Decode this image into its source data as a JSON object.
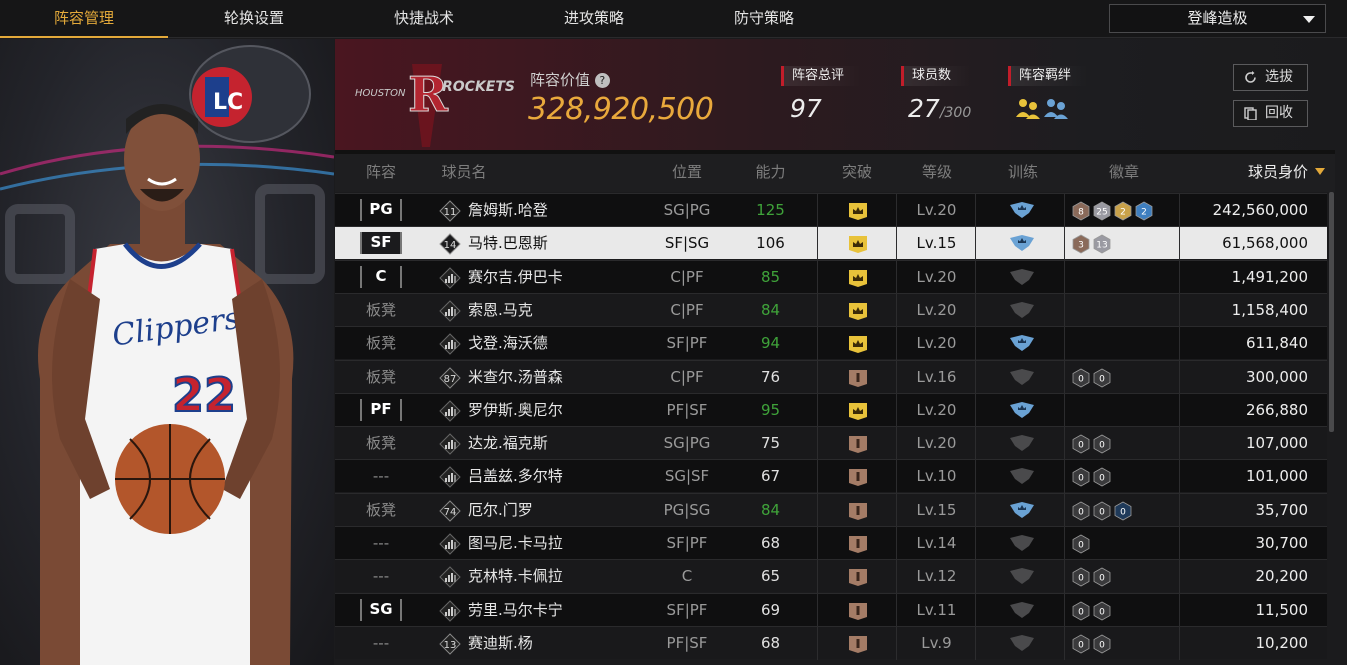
{
  "tabs": [
    {
      "label": "阵容管理",
      "active": true
    },
    {
      "label": "轮换设置"
    },
    {
      "label": "快捷战术"
    },
    {
      "label": "进攻策略"
    },
    {
      "label": "防守策略"
    }
  ],
  "mode_select": {
    "value": "登峰造极"
  },
  "team": {
    "logo_text": "HOUSTON ROCKETS",
    "value_label": "阵容价值",
    "value": "328,920,500"
  },
  "stats": {
    "rating_label": "阵容总评",
    "rating": "97",
    "players_label": "球员数",
    "players": "27",
    "players_max": "/300",
    "bond_label": "阵容羁绊"
  },
  "buttons": {
    "scout": "选拔",
    "recycle": "回收"
  },
  "columns": [
    "阵容",
    "球员名",
    "位置",
    "能力",
    "突破",
    "等级",
    "训练",
    "徽章",
    "球员身价"
  ],
  "featured_player": {
    "team": "Clippers",
    "number": "22"
  },
  "colors": {
    "accent": "#e3a93a",
    "green": "#3fa33a",
    "red": "#c21d2a",
    "gold_shield": "#e8c23a",
    "bronze_shield": "#a47c66",
    "blue_train": "#6aa2d4"
  },
  "rows": [
    {
      "slot": "PG",
      "slot_type": "tag",
      "num": "11",
      "name": "詹姆斯.哈登",
      "pos": "SG|PG",
      "ability": "125",
      "ability_green": true,
      "breakthrough": "gold",
      "level": "Lv.20",
      "train": "blue",
      "badges": [
        {
          "n": "8",
          "c": "#8a6a5a"
        },
        {
          "n": "25",
          "c": "#9a9aa2"
        },
        {
          "n": "2",
          "c": "#c9a24a"
        },
        {
          "n": "2",
          "c": "#3f7fc0"
        }
      ],
      "price": "242,560,000",
      "style": "dark"
    },
    {
      "slot": "SF",
      "slot_type": "tag",
      "num": "14",
      "name": "马特.巴恩斯",
      "pos": "SF|SG",
      "ability": "106",
      "ability_green": false,
      "breakthrough": "gold",
      "level": "Lv.15",
      "train": "blue",
      "badges": [
        {
          "n": "3",
          "c": "#8a6a5a"
        },
        {
          "n": "13",
          "c": "#9a9aa2"
        }
      ],
      "price": "61,568,000",
      "style": "sel"
    },
    {
      "slot": "C",
      "slot_type": "tag",
      "num": "",
      "name": "赛尔吉.伊巴卡",
      "pos": "C|PF",
      "ability": "85",
      "ability_green": true,
      "breakthrough": "gold",
      "level": "Lv.20",
      "train": "gray",
      "badges": [],
      "price": "1,491,200",
      "style": "dark"
    },
    {
      "slot": "板凳",
      "slot_type": "bench",
      "num": "",
      "name": "索恩.马克",
      "pos": "C|PF",
      "ability": "84",
      "ability_green": true,
      "breakthrough": "gold",
      "level": "Lv.20",
      "train": "gray",
      "badges": [],
      "price": "1,158,400",
      "style": "mid"
    },
    {
      "slot": "板凳",
      "slot_type": "bench",
      "num": "",
      "name": "戈登.海沃德",
      "pos": "SF|PF",
      "ability": "94",
      "ability_green": true,
      "breakthrough": "gold",
      "level": "Lv.20",
      "train": "blue",
      "badges": [],
      "price": "611,840",
      "style": "dark"
    },
    {
      "slot": "板凳",
      "slot_type": "bench",
      "num": "87",
      "name": "米查尔.汤普森",
      "pos": "C|PF",
      "ability": "76",
      "ability_green": false,
      "breakthrough": "bronze",
      "level": "Lv.16",
      "train": "gray",
      "badges": [
        {
          "n": "0",
          "c": "#3a3a3c"
        },
        {
          "n": "0",
          "c": "#3a3a3c"
        }
      ],
      "price": "300,000",
      "style": "mid"
    },
    {
      "slot": "PF",
      "slot_type": "tag",
      "num": "",
      "name": "罗伊斯.奥尼尔",
      "pos": "PF|SF",
      "ability": "95",
      "ability_green": true,
      "breakthrough": "gold",
      "level": "Lv.20",
      "train": "blue",
      "badges": [],
      "price": "266,880",
      "style": "dark"
    },
    {
      "slot": "板凳",
      "slot_type": "bench",
      "num": "",
      "name": "达龙.福克斯",
      "pos": "SG|PG",
      "ability": "75",
      "ability_green": false,
      "breakthrough": "bronze",
      "level": "Lv.20",
      "train": "gray",
      "badges": [
        {
          "n": "0",
          "c": "#3a3a3c"
        },
        {
          "n": "0",
          "c": "#3a3a3c"
        }
      ],
      "price": "107,000",
      "style": "mid"
    },
    {
      "slot": "---",
      "slot_type": "bench",
      "num": "",
      "name": "吕盖兹.多尔特",
      "pos": "SG|SF",
      "ability": "67",
      "ability_green": false,
      "breakthrough": "bronze",
      "level": "Lv.10",
      "train": "gray",
      "badges": [
        {
          "n": "0",
          "c": "#3a3a3c"
        },
        {
          "n": "0",
          "c": "#3a3a3c"
        }
      ],
      "price": "101,000",
      "style": "dark"
    },
    {
      "slot": "板凳",
      "slot_type": "bench",
      "num": "74",
      "name": "厄尔.门罗",
      "pos": "PG|SG",
      "ability": "84",
      "ability_green": true,
      "breakthrough": "bronze",
      "level": "Lv.15",
      "train": "blue",
      "badges": [
        {
          "n": "0",
          "c": "#3a3a3c"
        },
        {
          "n": "0",
          "c": "#3a3a3c"
        },
        {
          "n": "0",
          "c": "#1f3a5a"
        }
      ],
      "price": "35,700",
      "style": "mid"
    },
    {
      "slot": "---",
      "slot_type": "bench",
      "num": "",
      "name": "图马尼.卡马拉",
      "pos": "SF|PF",
      "ability": "68",
      "ability_green": false,
      "breakthrough": "bronze",
      "level": "Lv.14",
      "train": "gray",
      "badges": [
        {
          "n": "0",
          "c": "#3a3a3c"
        }
      ],
      "price": "30,700",
      "style": "dark"
    },
    {
      "slot": "---",
      "slot_type": "bench",
      "num": "",
      "name": "克林特.卡佩拉",
      "pos": "C",
      "ability": "65",
      "ability_green": false,
      "breakthrough": "bronze",
      "level": "Lv.12",
      "train": "gray",
      "badges": [
        {
          "n": "0",
          "c": "#3a3a3c"
        },
        {
          "n": "0",
          "c": "#3a3a3c"
        }
      ],
      "price": "20,200",
      "style": "mid"
    },
    {
      "slot": "SG",
      "slot_type": "tag",
      "num": "",
      "name": "劳里.马尔卡宁",
      "pos": "SF|PF",
      "ability": "69",
      "ability_green": false,
      "breakthrough": "bronze",
      "level": "Lv.11",
      "train": "gray",
      "badges": [
        {
          "n": "0",
          "c": "#3a3a3c"
        },
        {
          "n": "0",
          "c": "#3a3a3c"
        }
      ],
      "price": "11,500",
      "style": "dark"
    },
    {
      "slot": "---",
      "slot_type": "bench",
      "num": "13",
      "name": "赛迪斯.杨",
      "pos": "PF|SF",
      "ability": "68",
      "ability_green": false,
      "breakthrough": "bronze",
      "level": "Lv.9",
      "train": "gray",
      "badges": [
        {
          "n": "0",
          "c": "#3a3a3c"
        },
        {
          "n": "0",
          "c": "#3a3a3c"
        }
      ],
      "price": "10,200",
      "style": "mid"
    }
  ]
}
